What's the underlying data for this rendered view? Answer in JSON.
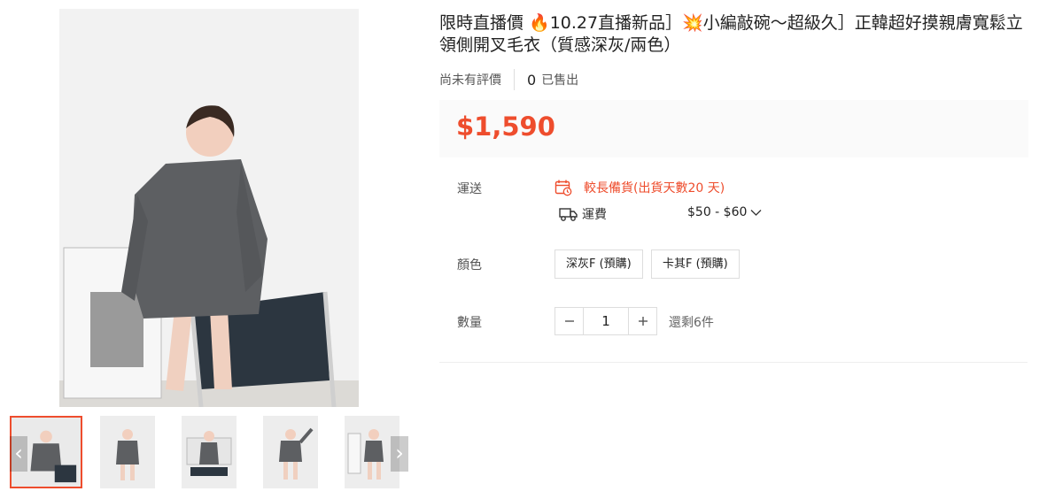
{
  "product": {
    "title": "限時直播價 🔥10.27直播新品］💥小編敲碗〜超級久］正韓超好摸親膚寬鬆立領側開叉毛衣（質感深灰/兩色）",
    "rating_text": "尚未有評價",
    "sold_count": "0",
    "sold_label": "已售出",
    "price": "$1,590"
  },
  "shipping": {
    "label": "運送",
    "preorder_text": "較長備貨(出貨天數20 天)",
    "fee_label": "運費",
    "fee_range": "$50 - $60"
  },
  "color": {
    "label": "顏色",
    "options": [
      "深灰F (預購)",
      "卡其F (預購)"
    ]
  },
  "quantity": {
    "label": "數量",
    "value": "1",
    "stock": "還剩6件"
  },
  "gallery": {
    "thumbnail_count": 5,
    "arrow_left": "‹",
    "arrow_right": "›"
  },
  "colors": {
    "accent": "#ee4d2d",
    "sweater": "#5d5f62",
    "chair": "#2c3640"
  }
}
